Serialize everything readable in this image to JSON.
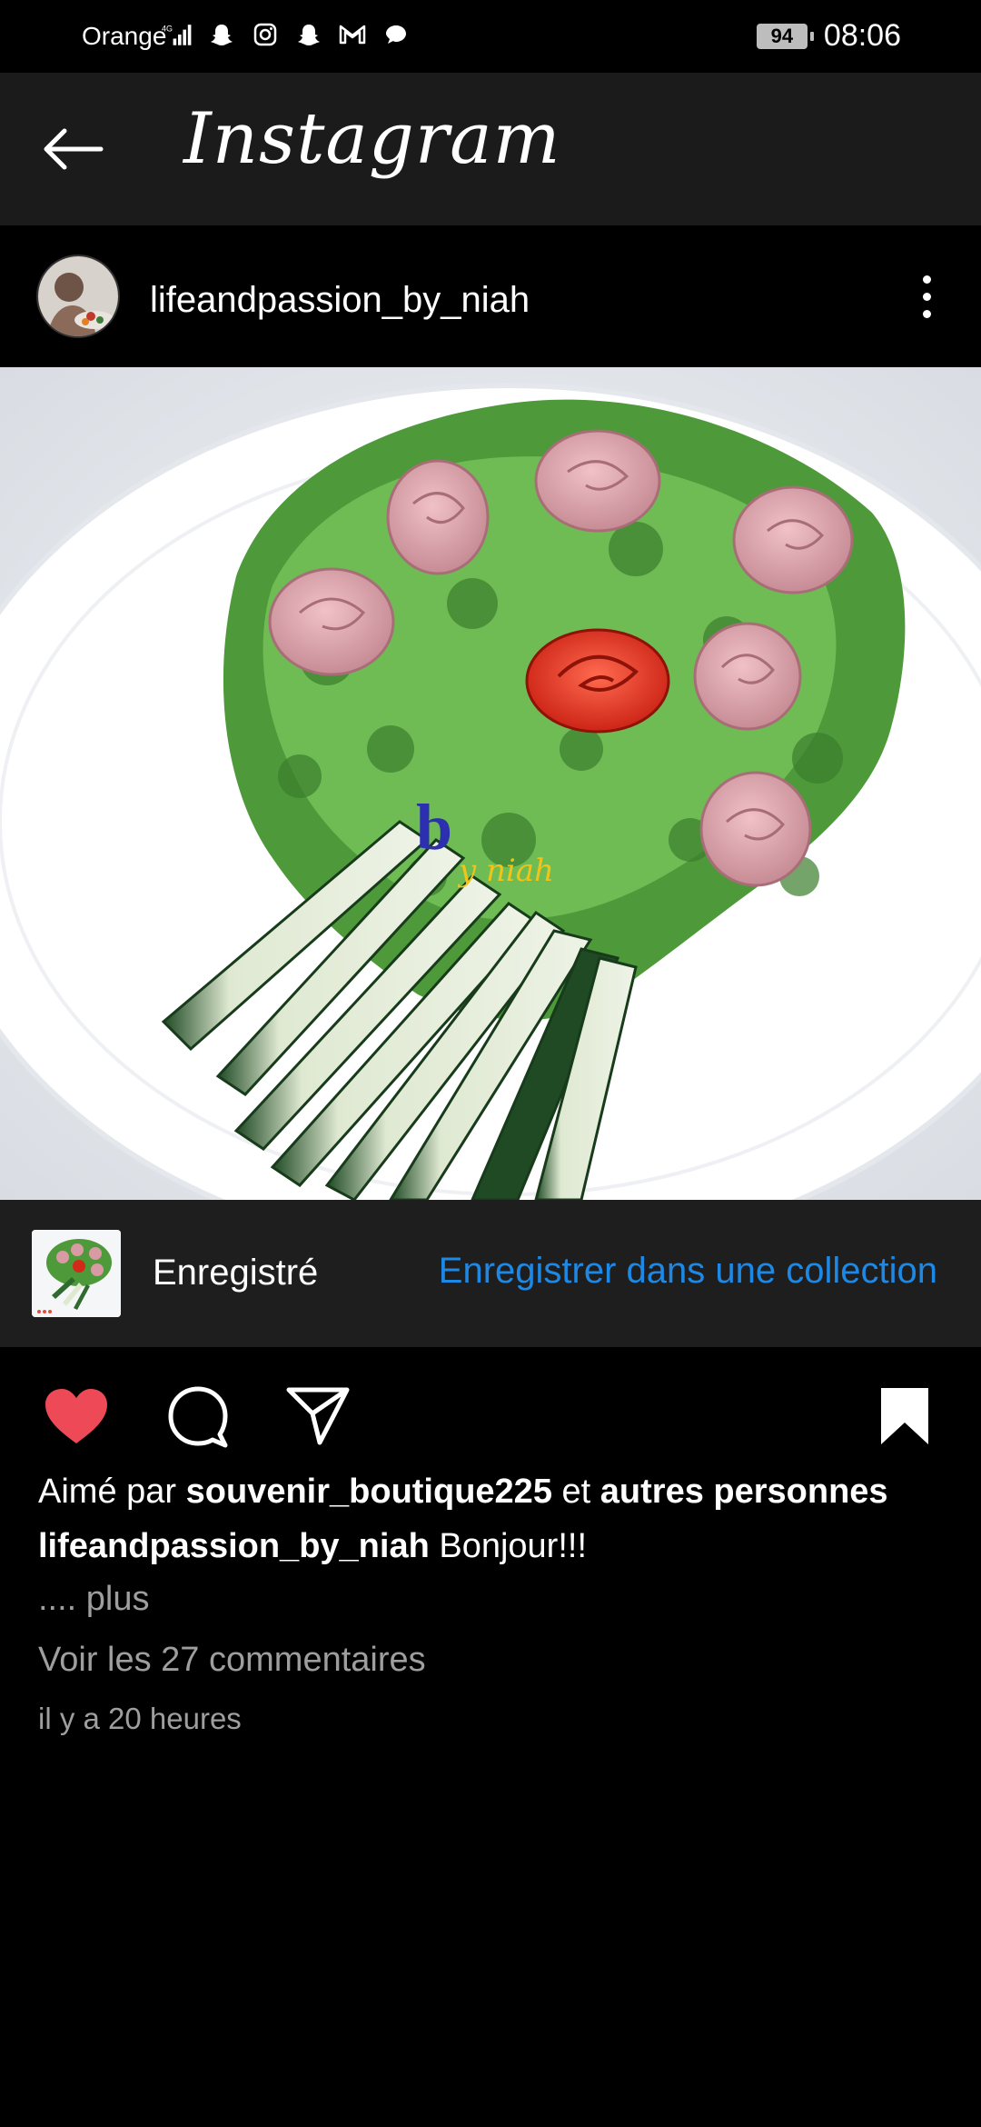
{
  "status_bar": {
    "carrier": "Orange",
    "network": "4G",
    "battery": "94",
    "time": "08:06",
    "icons": [
      "signal-icon",
      "snapchat-icon",
      "instagram-icon",
      "snapchat-icon",
      "gmail-icon",
      "message-icon"
    ]
  },
  "app_bar": {
    "title": "Instagram"
  },
  "post": {
    "username": "lifeandpassion_by_niah",
    "image_watermark": "by niah"
  },
  "saved_bar": {
    "label": "Enregistré",
    "link": "Enregistrer dans une collection"
  },
  "caption": {
    "liked_prefix": "Aimé par",
    "liked_user": "souvenir_boutique225",
    "liked_and": "et",
    "liked_others": "autres personnes",
    "author": "lifeandpassion_by_niah",
    "text": "Bonjour!!!",
    "more": ".... plus",
    "comments": "Voir les 27 commentaires",
    "time_ago": "il y a 20 heures"
  },
  "colors": {
    "heart": "#ed4956",
    "link": "#1e88e5",
    "appbar": "#1b1b1b",
    "savedbar": "#1e1e1e",
    "secondary_text": "#9e9e9e"
  }
}
